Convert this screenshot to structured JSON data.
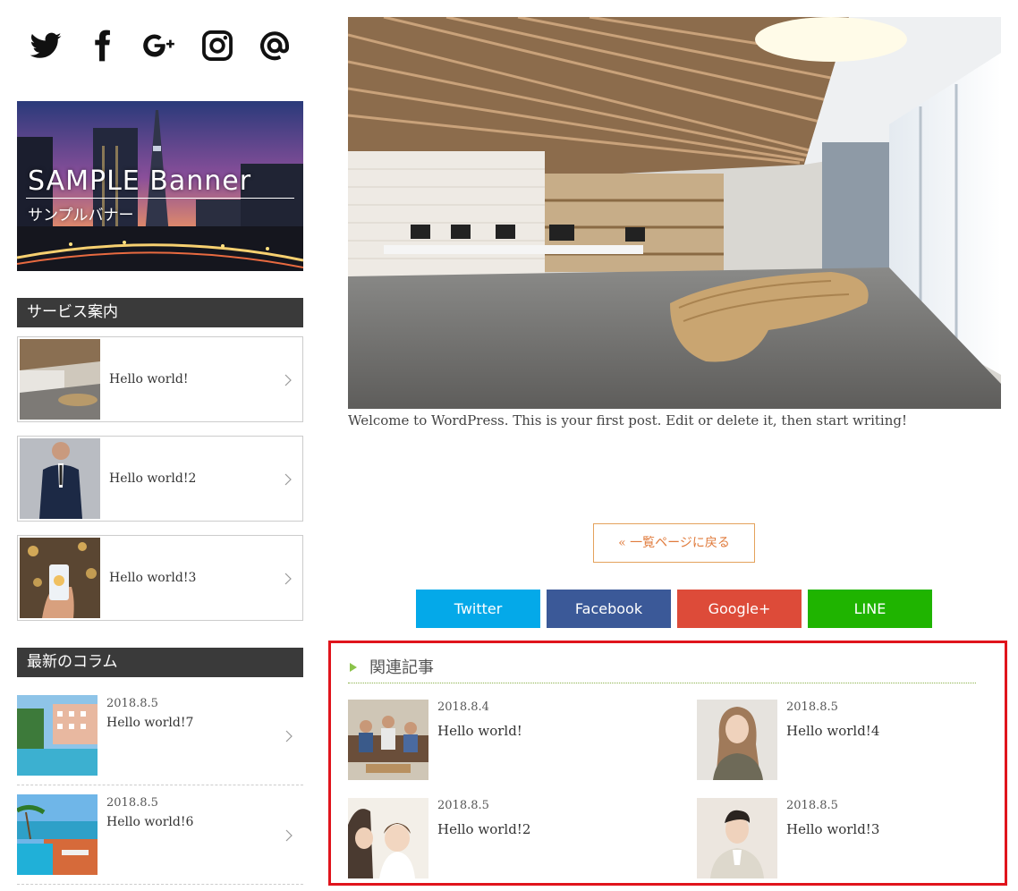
{
  "social": {
    "icons": [
      "twitter-icon",
      "facebook-icon",
      "google-plus-icon",
      "instagram-icon",
      "mail-at-icon"
    ]
  },
  "banner": {
    "title": "SAMPLE Banner",
    "subtitle": "サンプルバナー"
  },
  "services": {
    "heading": "サービス案内",
    "items": [
      {
        "label": "Hello world!"
      },
      {
        "label": "Hello world!2"
      },
      {
        "label": "Hello world!3"
      }
    ]
  },
  "columns": {
    "heading": "最新のコラム",
    "items": [
      {
        "date": "2018.8.5",
        "title": "Hello world!7"
      },
      {
        "date": "2018.8.5",
        "title": "Hello world!6"
      }
    ]
  },
  "post": {
    "body": "Welcome to WordPress. This is your first post. Edit or delete it, then start writing!",
    "back_label": "« 一覧ページに戻る"
  },
  "share": {
    "buttons": [
      {
        "label": "Twitter",
        "color": "#04a9e9"
      },
      {
        "label": "Facebook",
        "color": "#3b5998"
      },
      {
        "label": "Google+",
        "color": "#dd4b39"
      },
      {
        "label": "LINE",
        "color": "#1fb400"
      }
    ]
  },
  "related": {
    "heading": "関連記事",
    "items": [
      {
        "date": "2018.8.4",
        "title": "Hello world!"
      },
      {
        "date": "2018.8.5",
        "title": "Hello world!4"
      },
      {
        "date": "2018.8.5",
        "title": "Hello world!2"
      },
      {
        "date": "2018.8.5",
        "title": "Hello world!3"
      }
    ]
  },
  "colors": {
    "sidebar_heading_bg": "#3a3a3a",
    "back_button_border": "#e4a25c",
    "related_highlight": "#e0141c",
    "related_accent": "#8bc34a"
  }
}
